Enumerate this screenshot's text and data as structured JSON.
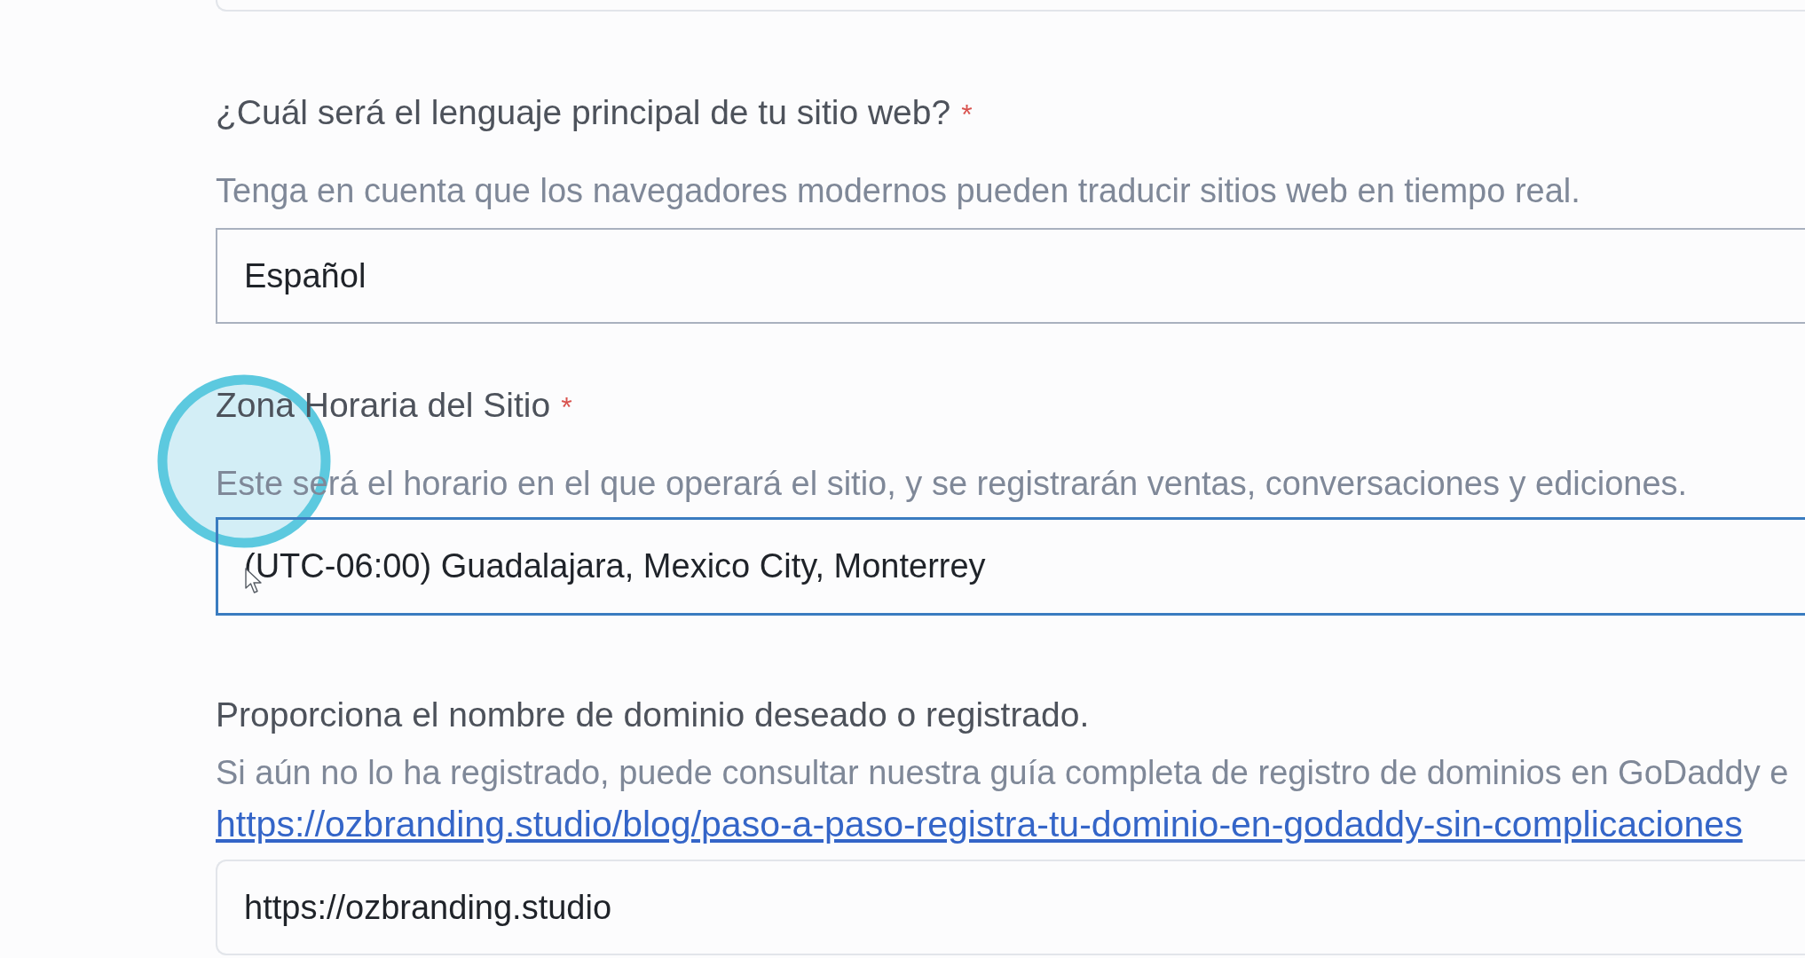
{
  "previous_field": {
    "kind": "text"
  },
  "questions": [
    {
      "label": "¿Cuál será el lenguaje principal de tu sitio web?",
      "required_mark": "*",
      "hint": "Tenga en cuenta que los navegadores modernos pueden traducir sitios web en tiempo real.",
      "field": {
        "kind": "select",
        "value": "Español",
        "focused": false
      }
    },
    {
      "label": "Zona Horaria del Sitio",
      "required_mark": "*",
      "hint": "Este será el horario en el que operará el sitio, y se registrarán ventas, conversaciones y ediciones.",
      "field": {
        "kind": "select",
        "value": "(UTC-06:00) Guadalajara, Mexico City, Monterrey",
        "focused": true
      }
    },
    {
      "label": "Proporciona el nombre de dominio deseado o registrado.",
      "hint": "Si aún no lo ha registrado, puede consultar nuestra guía completa de registro de dominios en GoDaddy e",
      "link": "https://ozbranding.studio/blog/paso-a-paso-registra-tu-dominio-en-godaddy-sin-complicaciones",
      "field": {
        "kind": "text",
        "value": "https://ozbranding.studio",
        "focused": false
      }
    }
  ]
}
